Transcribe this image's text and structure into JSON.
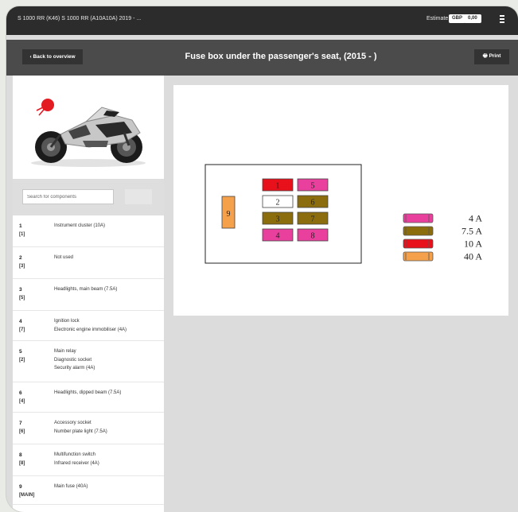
{
  "titlebar": {
    "vehicle": "S 1000 RR (K46) S 1000 RR (A10A10A) 2019 - ...",
    "estimate_label": "Estimate",
    "currency": "GBP",
    "amount": "0,00",
    "menu_icon": "document-icon"
  },
  "header": {
    "back_label": "Back to overview",
    "title": "Fuse box under the passenger's seat, (2015 - )",
    "print_label": "Print"
  },
  "search": {
    "placeholder": "Search for components"
  },
  "components": [
    {
      "number": "1",
      "position": "[1]",
      "lines": [
        "Instrument cluster (10A)"
      ]
    },
    {
      "number": "2",
      "position": "[3]",
      "lines": [
        "Not used"
      ]
    },
    {
      "number": "3",
      "position": "[5]",
      "lines": [
        "Headlights, main beam (7.5A)"
      ]
    },
    {
      "number": "4",
      "position": "[7]",
      "lines": [
        "Ignition lock",
        "Electronic engine immobiliser (4A)"
      ]
    },
    {
      "number": "5",
      "position": "[2]",
      "lines": [
        "Main relay",
        "Diagnostic socket",
        "Security alarm (4A)"
      ]
    },
    {
      "number": "6",
      "position": "[4]",
      "lines": [
        "Headlights, dipped beam (7.5A)"
      ]
    },
    {
      "number": "7",
      "position": "[6]",
      "lines": [
        "Accessory socket",
        "Number plate light (7.5A)"
      ]
    },
    {
      "number": "8",
      "position": "[8]",
      "lines": [
        "Multifunction switch",
        "Infrared receiver (4A)"
      ]
    },
    {
      "number": "9",
      "position": "[MAIN]",
      "lines": [
        "Main fuse (40A)"
      ]
    }
  ],
  "diagram": {
    "fuses": [
      {
        "label": "1",
        "color": "#e8101a"
      },
      {
        "label": "5",
        "color": "#e8409c"
      },
      {
        "label": "2",
        "color": "#ffffff"
      },
      {
        "label": "6",
        "color": "#8c6d0e"
      },
      {
        "label": "3",
        "color": "#8c6d0e"
      },
      {
        "label": "7",
        "color": "#8c6d0e"
      },
      {
        "label": "4",
        "color": "#e8409c"
      },
      {
        "label": "8",
        "color": "#e8409c"
      },
      {
        "label": "9",
        "color": "#f5a04a"
      }
    ],
    "legend": [
      {
        "label": "4 A",
        "color": "#e8409c"
      },
      {
        "label": "7.5 A",
        "color": "#8c6d0e"
      },
      {
        "label": "10 A",
        "color": "#e8101a"
      },
      {
        "label": "40 A",
        "color": "#f5a04a"
      }
    ]
  }
}
